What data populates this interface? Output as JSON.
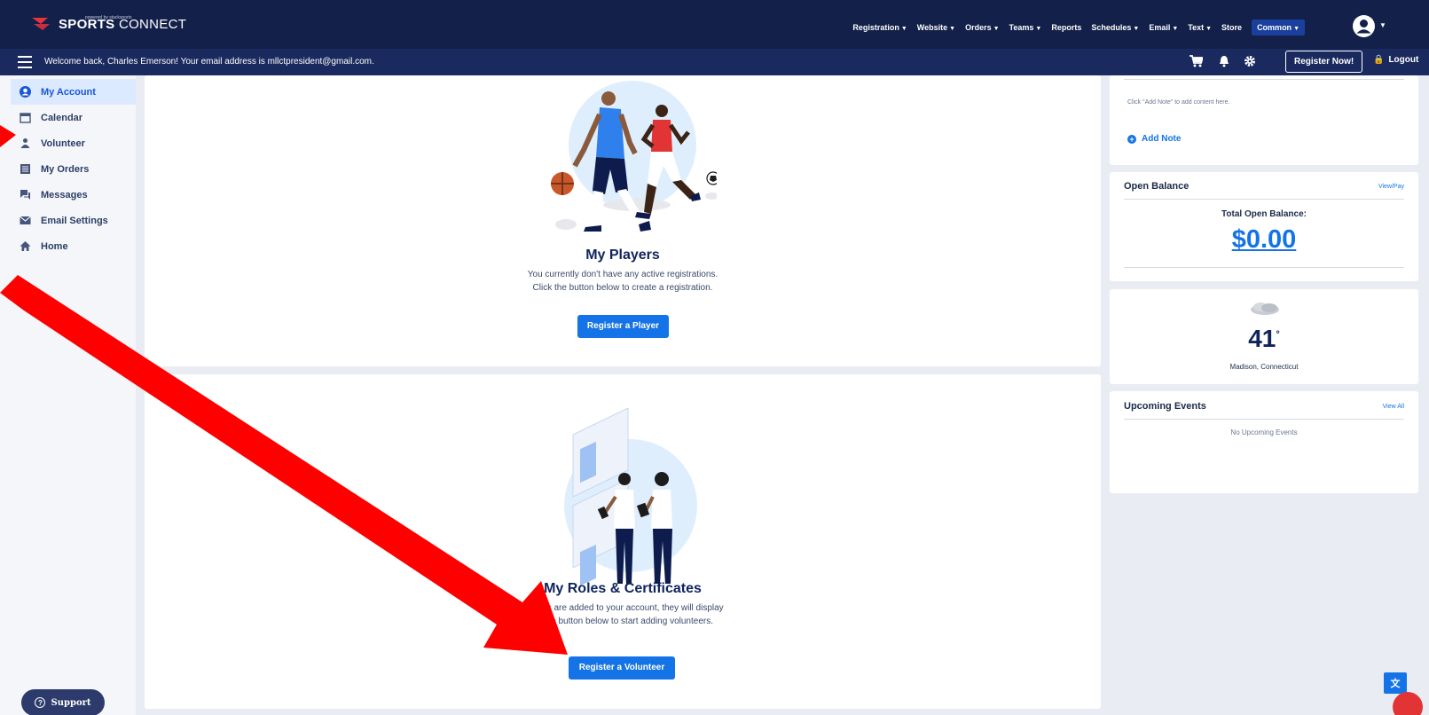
{
  "brand": {
    "name_bold": "SPORTS",
    "name_light": "CONNECT",
    "tagline": "powered by stacksports"
  },
  "topnav": [
    {
      "label": "Registration",
      "dropdown": true
    },
    {
      "label": "Website",
      "dropdown": true
    },
    {
      "label": "Orders",
      "dropdown": true
    },
    {
      "label": "Teams",
      "dropdown": true
    },
    {
      "label": "Reports",
      "dropdown": false
    },
    {
      "label": "Schedules",
      "dropdown": true
    },
    {
      "label": "Email",
      "dropdown": true
    },
    {
      "label": "Text",
      "dropdown": true
    },
    {
      "label": "Store",
      "dropdown": false
    },
    {
      "label": "Common",
      "dropdown": true
    }
  ],
  "subbar": {
    "welcome": "Welcome back, Charles Emerson! Your email address is mllctpresident@gmail.com.",
    "register_now": "Register Now!",
    "logout": "Logout",
    "icons": [
      "cart-icon",
      "bell-icon",
      "gear-icon"
    ]
  },
  "sidebar": {
    "items": [
      {
        "label": "My Account",
        "icon": "user-circle-icon",
        "active": true
      },
      {
        "label": "Calendar",
        "icon": "calendar-icon",
        "active": false
      },
      {
        "label": "Volunteer",
        "icon": "person-icon",
        "active": false
      },
      {
        "label": "My Orders",
        "icon": "list-icon",
        "active": false
      },
      {
        "label": "Messages",
        "icon": "chat-icon",
        "active": false
      },
      {
        "label": "Email Settings",
        "icon": "envelope-icon",
        "active": false
      },
      {
        "label": "Home",
        "icon": "home-icon",
        "active": false
      }
    ],
    "support": "Support"
  },
  "players": {
    "title": "My Players",
    "line1": "You currently don't have any active registrations.",
    "line2": "Click the button below to create a registration.",
    "button": "Register a Player"
  },
  "roles": {
    "title": "My Roles & Certificates",
    "line1": "unteers are added to your account, they will display",
    "line2": "ck the button below to start adding volunteers.",
    "button": "Register a Volunteer"
  },
  "notes": {
    "empty_text": "Click \"Add Note\" to add content here.",
    "add_label": "Add Note"
  },
  "balance": {
    "title": "Open Balance",
    "link": "View/Pay",
    "label": "Total Open Balance:",
    "amount": "$0.00"
  },
  "weather": {
    "temperature": "41",
    "degree": "°",
    "location": "Madison, Connecticut",
    "icon": "cloud-icon"
  },
  "events": {
    "title": "Upcoming Events",
    "link": "View All",
    "empty_text": "No Upcoming Events"
  },
  "colors": {
    "navy": "#13204a",
    "subbar": "#1a2a5e",
    "accent": "#1473e6",
    "annotation_arrow": "#ff0000"
  }
}
